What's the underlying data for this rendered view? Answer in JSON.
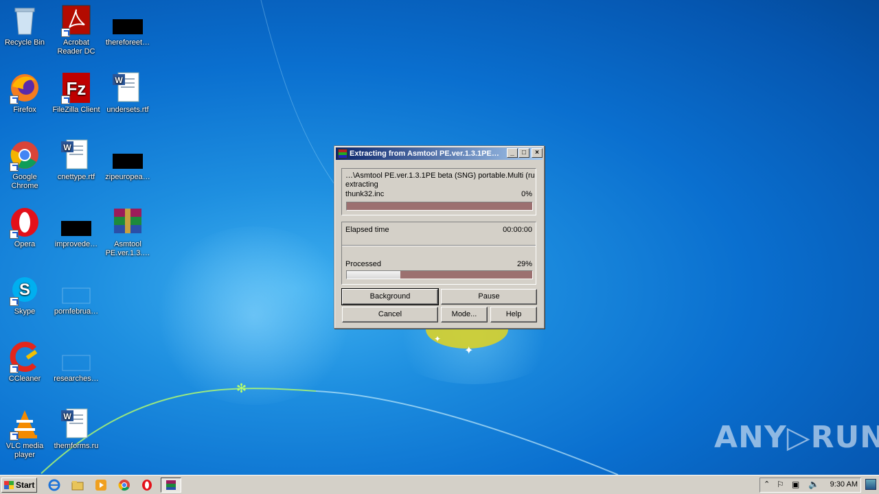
{
  "desktop": {
    "icons": [
      {
        "label": "Recycle Bin"
      },
      {
        "label": "Acrobat Reader DC"
      },
      {
        "label": "thereforeet…"
      },
      {
        "label": "Firefox"
      },
      {
        "label": "FileZilla Client"
      },
      {
        "label": "undersets.rtf"
      },
      {
        "label": "Google Chrome"
      },
      {
        "label": "cnettype.rtf"
      },
      {
        "label": "zipeuropea…"
      },
      {
        "label": "Opera"
      },
      {
        "label": "improvede…"
      },
      {
        "label": "Asmtool PE.ver.1.3.…"
      },
      {
        "label": "Skype"
      },
      {
        "label": "pornfebrua…"
      },
      {
        "label": "CCleaner"
      },
      {
        "label": "researches…"
      },
      {
        "label": "VLC media player"
      },
      {
        "label": "themforms.ru"
      }
    ]
  },
  "dialog": {
    "title": "Extracting from Asmtool PE.ver.1.3.1PE…",
    "minimize": "_",
    "maximize": "□",
    "close": "×",
    "archive_path": "…\\Asmtool PE.ver.1.3.1PE beta (SNG) portable.Multi (ru",
    "status": "extracting",
    "current_file": "thunk32.inc",
    "file_percent": "0%",
    "file_progress": 0,
    "elapsed_label": "Elapsed time",
    "elapsed_value": "00:00:00",
    "processed_label": "Processed",
    "processed_percent": "29%",
    "processed_progress": 0.29,
    "buttons": {
      "background": "Background",
      "pause": "Pause",
      "cancel": "Cancel",
      "mode": "Mode...",
      "help": "Help"
    }
  },
  "taskbar": {
    "start_label": "Start",
    "clock": "9:30 AM"
  },
  "watermark": "ANY▷RUN"
}
